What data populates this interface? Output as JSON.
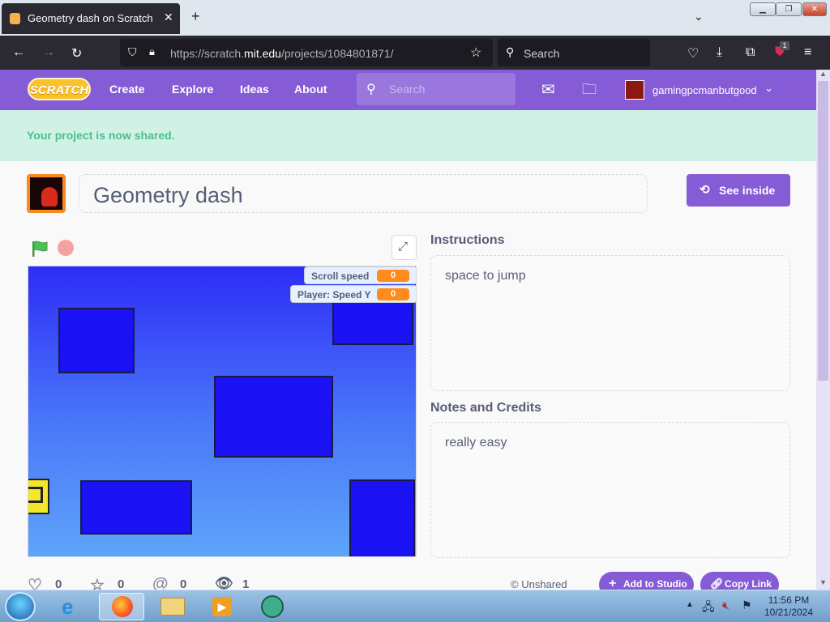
{
  "browser": {
    "tab_title": "Geometry dash on Scratch",
    "url_scheme": "https://scratch.",
    "url_domain": "mit.edu",
    "url_path": "/projects/1084801871/",
    "search_placeholder": "Search",
    "notification_count": "1"
  },
  "scratch_nav": {
    "logo": "SCRATCH",
    "links": [
      "Create",
      "Explore",
      "Ideas",
      "About"
    ],
    "search_placeholder": "Search",
    "username": "gamingpcmanbutgood"
  },
  "banner": {
    "message": "Your project is now shared."
  },
  "project": {
    "title": "Geometry dash",
    "see_inside_label": "See inside"
  },
  "stage": {
    "monitors": [
      {
        "label": "Scroll speed",
        "value": "0"
      },
      {
        "label": "Player: Speed Y",
        "value": "0"
      }
    ]
  },
  "instructions": {
    "heading": "Instructions",
    "text": "space to jump"
  },
  "notes": {
    "heading": "Notes and Credits",
    "text": "really easy"
  },
  "stats": {
    "loves": "0",
    "favorites": "0",
    "remixes": "0",
    "views": "1"
  },
  "sharing": {
    "status": "Unshared",
    "add_to_studio": "Add to Studio",
    "copy_link": "Copy Link"
  },
  "taskbar": {
    "time": "11:56 PM",
    "date": "10/21/2024"
  },
  "colors": {
    "scratch_purple": "#855cd6",
    "banner_bg": "#d0f2e6",
    "banner_text": "#4cbe8c",
    "monitor_value": "#ff8c1a"
  }
}
